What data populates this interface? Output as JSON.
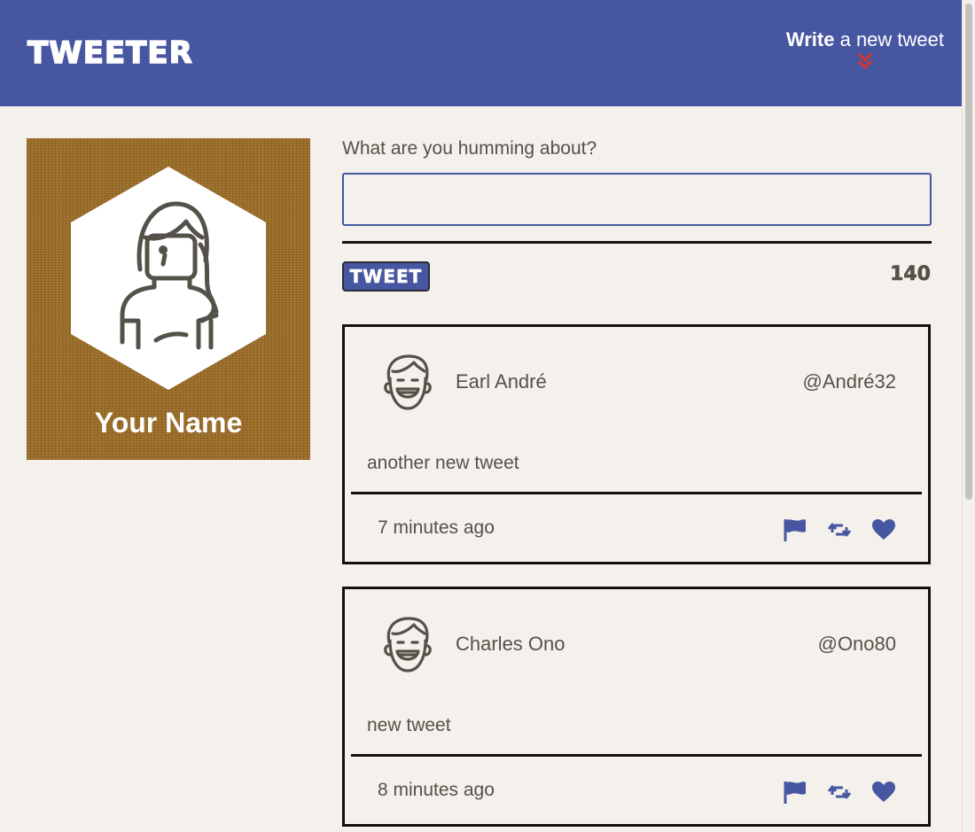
{
  "nav": {
    "brand": "TWEETER",
    "compose_bold": "Write",
    "compose_rest": " a new tweet",
    "accent": "#4756a0",
    "chevron_color": "#d9342b"
  },
  "profile": {
    "name": "Your Name",
    "avatar_icon": "woman-avatar-icon"
  },
  "compose": {
    "label": "What are you humming about?",
    "value": "",
    "button_label": "TWEET",
    "counter": "140"
  },
  "tweets": [
    {
      "name": "Earl André",
      "handle": "@André32",
      "body": "another new tweet",
      "time": "7 minutes ago"
    },
    {
      "name": "Charles Ono",
      "handle": "@Ono80",
      "body": "new tweet",
      "time": "8 minutes ago"
    }
  ],
  "action_icons": [
    "flag-icon",
    "retweet-icon",
    "heart-icon"
  ]
}
